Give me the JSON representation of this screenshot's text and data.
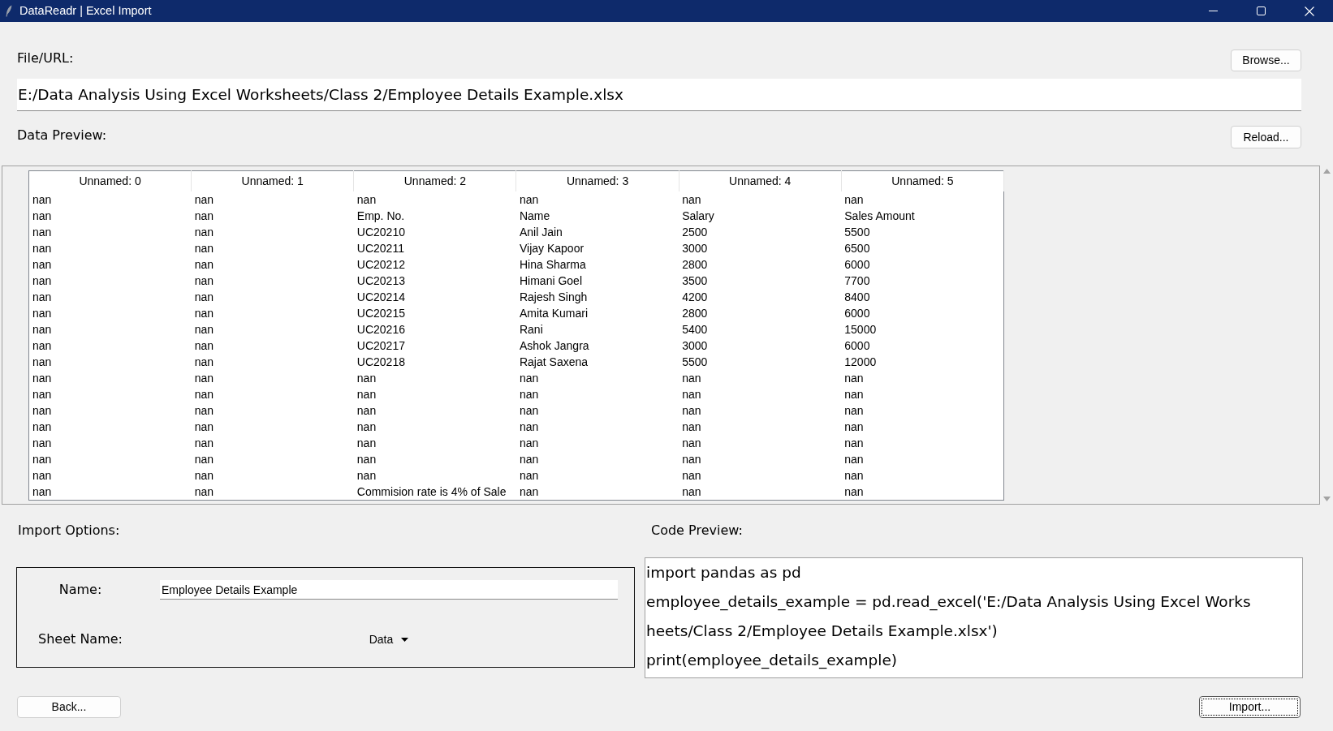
{
  "window": {
    "title": "DataReadr | Excel Import"
  },
  "file": {
    "label": "File/URL:",
    "value": "E:/Data Analysis Using Excel Worksheets/Class 2/Employee Details Example.xlsx",
    "browse_button": {
      "label": "Browse...",
      "focused": false
    }
  },
  "data_preview": {
    "label": "Data Preview:",
    "reload_button": {
      "label": "Reload...",
      "focused": false
    },
    "table": {
      "columns": [
        "Unnamed: 0",
        "Unnamed: 1",
        "Unnamed: 2",
        "Unnamed: 3",
        "Unnamed: 4",
        "Unnamed: 5"
      ],
      "rows": [
        [
          "nan",
          "nan",
          "nan",
          "nan",
          "nan",
          "nan"
        ],
        [
          "nan",
          "nan",
          "Emp. No.",
          "Name",
          "Salary",
          "Sales Amount"
        ],
        [
          "nan",
          "nan",
          "UC20210",
          "Anil Jain",
          "2500",
          "5500"
        ],
        [
          "nan",
          "nan",
          "UC20211",
          "Vijay Kapoor",
          "3000",
          "6500"
        ],
        [
          "nan",
          "nan",
          "UC20212",
          "Hina Sharma",
          "2800",
          "6000"
        ],
        [
          "nan",
          "nan",
          "UC20213",
          "Himani Goel",
          "3500",
          "7700"
        ],
        [
          "nan",
          "nan",
          "UC20214",
          "Rajesh Singh",
          "4200",
          "8400"
        ],
        [
          "nan",
          "nan",
          "UC20215",
          "Amita Kumari",
          "2800",
          "6000"
        ],
        [
          "nan",
          "nan",
          "UC20216",
          "Rani",
          "5400",
          "15000"
        ],
        [
          "nan",
          "nan",
          "UC20217",
          "Ashok Jangra",
          "3000",
          "6000"
        ],
        [
          "nan",
          "nan",
          "UC20218",
          "Rajat Saxena",
          "5500",
          "12000"
        ],
        [
          "nan",
          "nan",
          "nan",
          "nan",
          "nan",
          "nan"
        ],
        [
          "nan",
          "nan",
          "nan",
          "nan",
          "nan",
          "nan"
        ],
        [
          "nan",
          "nan",
          "nan",
          "nan",
          "nan",
          "nan"
        ],
        [
          "nan",
          "nan",
          "nan",
          "nan",
          "nan",
          "nan"
        ],
        [
          "nan",
          "nan",
          "nan",
          "nan",
          "nan",
          "nan"
        ],
        [
          "nan",
          "nan",
          "nan",
          "nan",
          "nan",
          "nan"
        ],
        [
          "nan",
          "nan",
          "nan",
          "nan",
          "nan",
          "nan"
        ],
        [
          "nan",
          "nan",
          "Commision rate is 4% of Sale",
          "nan",
          "nan",
          "nan"
        ]
      ]
    }
  },
  "import_options": {
    "label": "Import Options:",
    "name": {
      "label": "Name:",
      "value": "Employee Details Example"
    },
    "sheet_name": {
      "label": "Sheet Name:",
      "value": "Data"
    }
  },
  "code_preview": {
    "label": "Code Preview:",
    "lines": [
      "import pandas as pd",
      "employee_details_example = pd.read_excel('E:/Data Analysis Using Excel Works",
      "heets/Class 2/Employee Details Example.xlsx')",
      "print(employee_details_example)"
    ]
  },
  "back_button": {
    "label": "Back...",
    "focused": false
  },
  "import_button": {
    "label": "Import...",
    "focused": true
  }
}
